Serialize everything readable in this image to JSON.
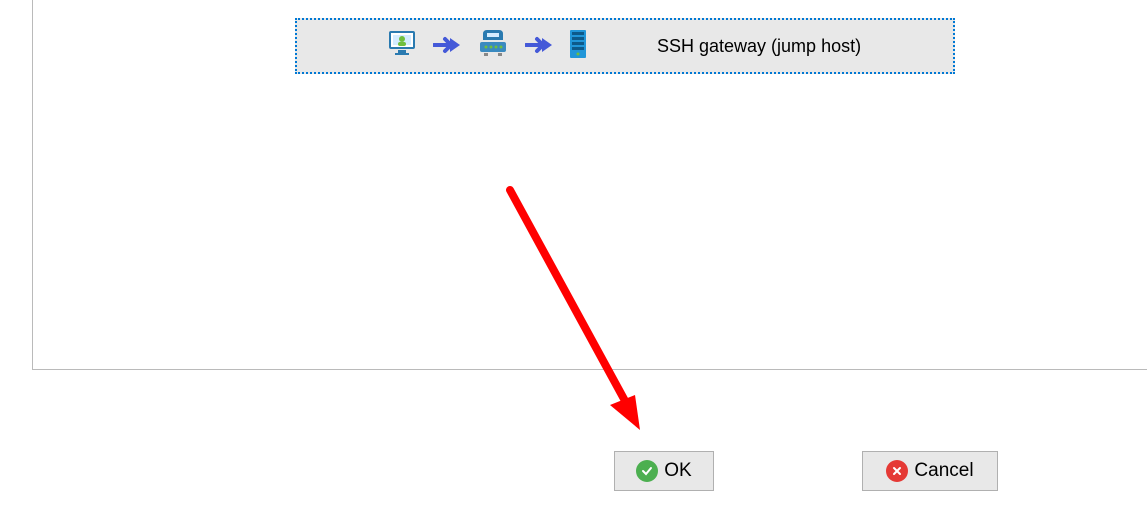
{
  "gateway": {
    "label": "SSH gateway (jump host)",
    "icons": [
      "user-monitor-icon",
      "arrow-right-icon",
      "network-device-icon",
      "arrow-right-icon",
      "server-icon"
    ]
  },
  "buttons": {
    "ok_label": "OK",
    "cancel_label": "Cancel"
  },
  "colors": {
    "selection_border": "#0078d4",
    "arrow_blue": "#4459d8",
    "ok_green": "#4caf50",
    "cancel_red": "#e53935",
    "annotation_red": "#ff0000"
  }
}
